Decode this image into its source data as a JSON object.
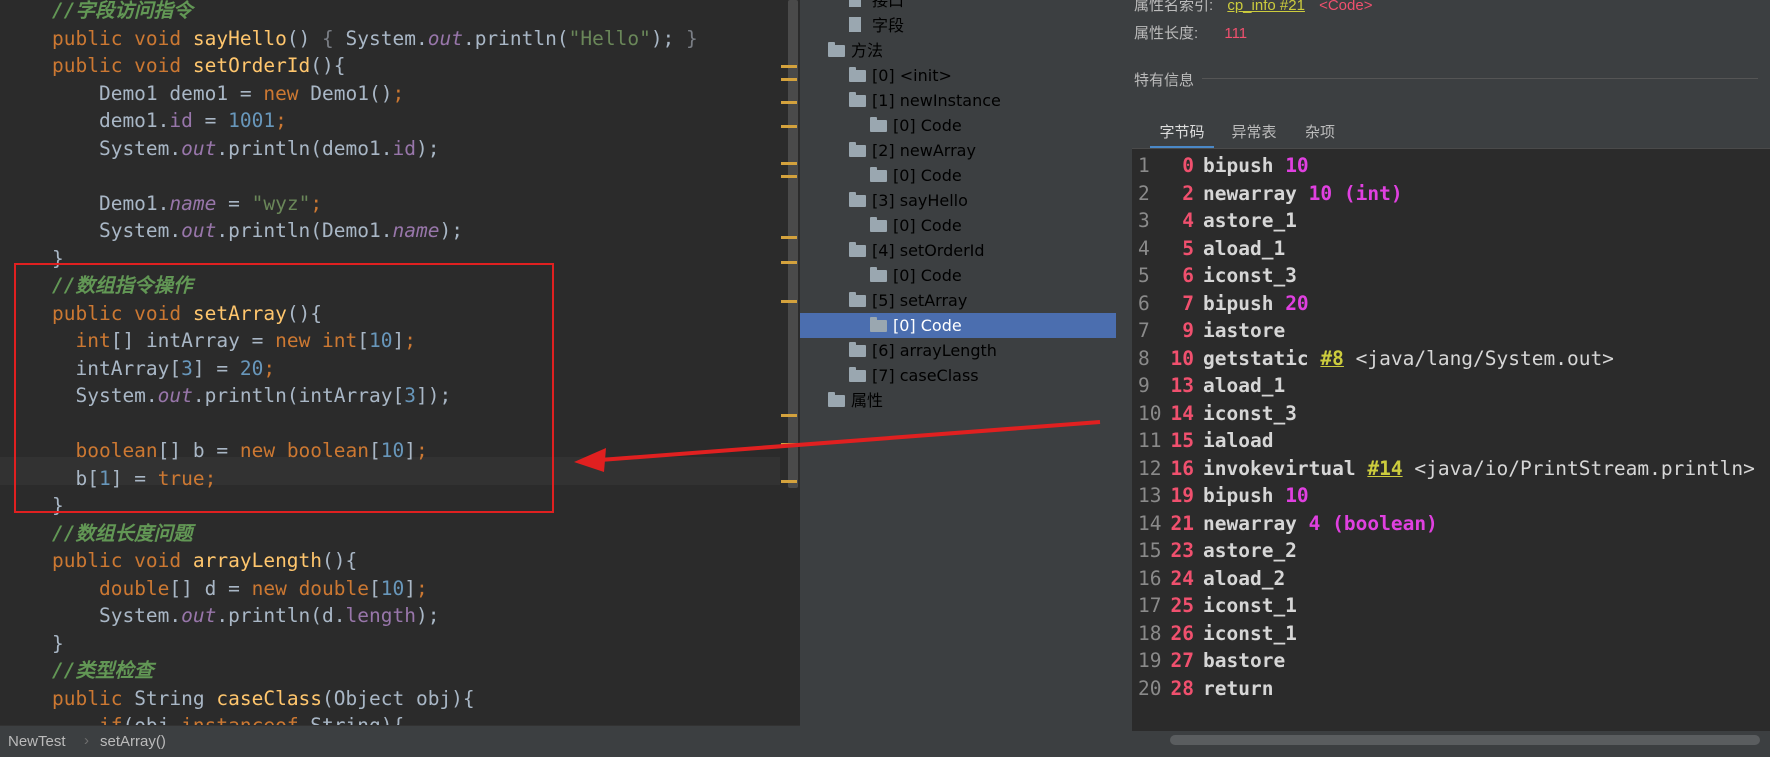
{
  "editor": {
    "lines": [
      [
        [
          "cm",
          "//字段访问指令"
        ]
      ],
      [
        [
          "kw",
          "public void "
        ],
        [
          "mt",
          "sayHello"
        ],
        [
          "",
          "() "
        ],
        [
          "fn",
          "{ "
        ],
        [
          "",
          "System."
        ],
        [
          "it",
          "out"
        ],
        [
          "",
          ".println("
        ],
        [
          "st",
          "\"Hello\""
        ],
        [
          "",
          ");"
        ],
        [
          "fn",
          " }"
        ]
      ],
      [
        [
          "kw",
          "public void "
        ],
        [
          "mt",
          "setOrderId"
        ],
        [
          "",
          "(){"
        ]
      ],
      [
        [
          "",
          "    Demo1 demo1 = "
        ],
        [
          "kw",
          "new "
        ],
        [
          "",
          "Demo1()"
        ],
        [
          "kw",
          ";"
        ]
      ],
      [
        [
          "",
          "    demo1."
        ],
        [
          "fd",
          "id"
        ],
        [
          "",
          " = "
        ],
        [
          "nm",
          "1001"
        ],
        [
          "kw",
          ";"
        ]
      ],
      [
        [
          "",
          "    System."
        ],
        [
          "it",
          "out"
        ],
        [
          "",
          ".println(demo1."
        ],
        [
          "fd",
          "id"
        ],
        [
          "",
          ");"
        ]
      ],
      [
        [
          "",
          ""
        ]
      ],
      [
        [
          "",
          "    Demo1."
        ],
        [
          "it",
          "name"
        ],
        [
          "",
          " = "
        ],
        [
          "st",
          "\"wyz\""
        ],
        [
          "kw",
          ";"
        ]
      ],
      [
        [
          "",
          "    System."
        ],
        [
          "it",
          "out"
        ],
        [
          "",
          ".println(Demo1."
        ],
        [
          "it",
          "name"
        ],
        [
          "",
          ");"
        ]
      ],
      [
        [
          "",
          "}"
        ]
      ],
      [
        [
          "cm",
          "//数组指令操作"
        ]
      ],
      [
        [
          "kw",
          "public void "
        ],
        [
          "mt",
          "setArray"
        ],
        [
          "",
          "(){"
        ]
      ],
      [
        [
          "",
          "  "
        ],
        [
          "kw",
          "int"
        ],
        [
          "",
          "[] intArray = "
        ],
        [
          "kw",
          "new int"
        ],
        [
          "",
          "["
        ],
        [
          "nm",
          "10"
        ],
        [
          "",
          "]"
        ],
        [
          "kw",
          ";"
        ]
      ],
      [
        [
          "",
          "  intArray["
        ],
        [
          "nm",
          "3"
        ],
        [
          "",
          "] = "
        ],
        [
          "nm",
          "20"
        ],
        [
          "kw",
          ";"
        ]
      ],
      [
        [
          "",
          "  System."
        ],
        [
          "it",
          "out"
        ],
        [
          "",
          ".println(intArray["
        ],
        [
          "nm",
          "3"
        ],
        [
          "",
          "]);"
        ]
      ],
      [
        [
          "",
          ""
        ]
      ],
      [
        [
          "",
          "  "
        ],
        [
          "kw",
          "boolean"
        ],
        [
          "",
          "[] b = "
        ],
        [
          "kw",
          "new boolean"
        ],
        [
          "",
          "["
        ],
        [
          "nm",
          "10"
        ],
        [
          "",
          "]"
        ],
        [
          "kw",
          ";"
        ]
      ],
      [
        [
          "",
          "  b["
        ],
        [
          "nm",
          "1"
        ],
        [
          "",
          "] = "
        ],
        [
          "kw",
          "true;"
        ]
      ],
      [
        [
          "",
          "}"
        ]
      ],
      [
        [
          "cm",
          "//数组长度问题"
        ]
      ],
      [
        [
          "kw",
          "public void "
        ],
        [
          "mt",
          "arrayLength"
        ],
        [
          "",
          "(){"
        ]
      ],
      [
        [
          "",
          "    "
        ],
        [
          "kw",
          "double"
        ],
        [
          "",
          "[] d = "
        ],
        [
          "kw",
          "new double"
        ],
        [
          "",
          "["
        ],
        [
          "nm",
          "10"
        ],
        [
          "",
          "]"
        ],
        [
          "kw",
          ";"
        ]
      ],
      [
        [
          "",
          "    System."
        ],
        [
          "it",
          "out"
        ],
        [
          "",
          ".println(d."
        ],
        [
          "fd",
          "length"
        ],
        [
          "",
          ");"
        ]
      ],
      [
        [
          "",
          "}"
        ]
      ],
      [
        [
          "cm",
          "//类型检查"
        ]
      ],
      [
        [
          "kw",
          "public "
        ],
        [
          "",
          "String "
        ],
        [
          "mt",
          "caseClass"
        ],
        [
          "",
          "(Object obj){"
        ]
      ],
      [
        [
          "",
          "    "
        ],
        [
          "kw",
          "if"
        ],
        [
          "",
          "(obj "
        ],
        [
          "kw",
          "instanceof "
        ],
        [
          "",
          "String){"
        ]
      ]
    ],
    "breadcrumb": [
      "NewTest",
      "setArray()"
    ],
    "breadcrumb_sep": "›"
  },
  "tree": {
    "items": [
      {
        "label": "接口",
        "level": 1,
        "type": "file",
        "arrow": ""
      },
      {
        "label": "字段",
        "level": 1,
        "type": "file",
        "arrow": ""
      },
      {
        "label": "方法",
        "level": 0,
        "type": "folder",
        "arrow": "▼"
      },
      {
        "label": "[0] <init>",
        "level": 1,
        "type": "folder",
        "arrow": "▶"
      },
      {
        "label": "[1] newInstance",
        "level": 1,
        "type": "folder",
        "arrow": "▼"
      },
      {
        "label": "[0] Code",
        "level": 2,
        "type": "folder",
        "arrow": "▶"
      },
      {
        "label": "[2] newArray",
        "level": 1,
        "type": "folder",
        "arrow": "▼"
      },
      {
        "label": "[0] Code",
        "level": 2,
        "type": "folder",
        "arrow": "▶"
      },
      {
        "label": "[3] sayHello",
        "level": 1,
        "type": "folder",
        "arrow": "▼"
      },
      {
        "label": "[0] Code",
        "level": 2,
        "type": "folder",
        "arrow": "▶"
      },
      {
        "label": "[4] setOrderId",
        "level": 1,
        "type": "folder",
        "arrow": "▼"
      },
      {
        "label": "[0] Code",
        "level": 2,
        "type": "folder",
        "arrow": "▶"
      },
      {
        "label": "[5] setArray",
        "level": 1,
        "type": "folder",
        "arrow": "▼"
      },
      {
        "label": "[0] Code",
        "level": 2,
        "type": "folder",
        "arrow": "▶",
        "selected": true
      },
      {
        "label": "[6] arrayLength",
        "level": 1,
        "type": "folder",
        "arrow": "▶"
      },
      {
        "label": "[7] caseClass",
        "level": 1,
        "type": "folder",
        "arrow": "▶"
      },
      {
        "label": "属性",
        "level": 0,
        "type": "folder",
        "arrow": "▶"
      }
    ]
  },
  "details": {
    "name_index_label": "属性名索引:",
    "name_index_link": "cp_info #21",
    "name_index_tag": "<Code>",
    "length_label": "属性长度:",
    "length_value": "111",
    "special_info": "特有信息",
    "tabs": [
      "字节码",
      "异常表",
      "杂项"
    ],
    "bytecode": [
      {
        "n": "1",
        "pc": "0",
        "op": "bipush",
        "arg": "10"
      },
      {
        "n": "2",
        "pc": "2",
        "op": "newarray",
        "arg": "10 (int)"
      },
      {
        "n": "3",
        "pc": "4",
        "op": "astore_1"
      },
      {
        "n": "4",
        "pc": "5",
        "op": "aload_1"
      },
      {
        "n": "5",
        "pc": "6",
        "op": "iconst_3"
      },
      {
        "n": "6",
        "pc": "7",
        "op": "bipush",
        "arg": "20"
      },
      {
        "n": "7",
        "pc": "9",
        "op": "iastore"
      },
      {
        "n": "8",
        "pc": "10",
        "op": "getstatic",
        "ref": "#8",
        "comment": "<java/lang/System.out>"
      },
      {
        "n": "9",
        "pc": "13",
        "op": "aload_1"
      },
      {
        "n": "10",
        "pc": "14",
        "op": "iconst_3"
      },
      {
        "n": "11",
        "pc": "15",
        "op": "iaload"
      },
      {
        "n": "12",
        "pc": "16",
        "op": "invokevirtual",
        "ref": "#14",
        "comment": "<java/io/PrintStream.println>"
      },
      {
        "n": "13",
        "pc": "19",
        "op": "bipush",
        "arg": "10"
      },
      {
        "n": "14",
        "pc": "21",
        "op": "newarray",
        "arg": "4 (boolean)"
      },
      {
        "n": "15",
        "pc": "23",
        "op": "astore_2"
      },
      {
        "n": "16",
        "pc": "24",
        "op": "aload_2"
      },
      {
        "n": "17",
        "pc": "25",
        "op": "iconst_1"
      },
      {
        "n": "18",
        "pc": "26",
        "op": "iconst_1"
      },
      {
        "n": "19",
        "pc": "27",
        "op": "bastore"
      },
      {
        "n": "20",
        "pc": "28",
        "op": "return"
      }
    ]
  },
  "colors": {
    "annotation_red": "#e02020",
    "selection": "#4b6eaf",
    "pc_red": "#f0506e",
    "arg_magenta": "#e040e0"
  }
}
